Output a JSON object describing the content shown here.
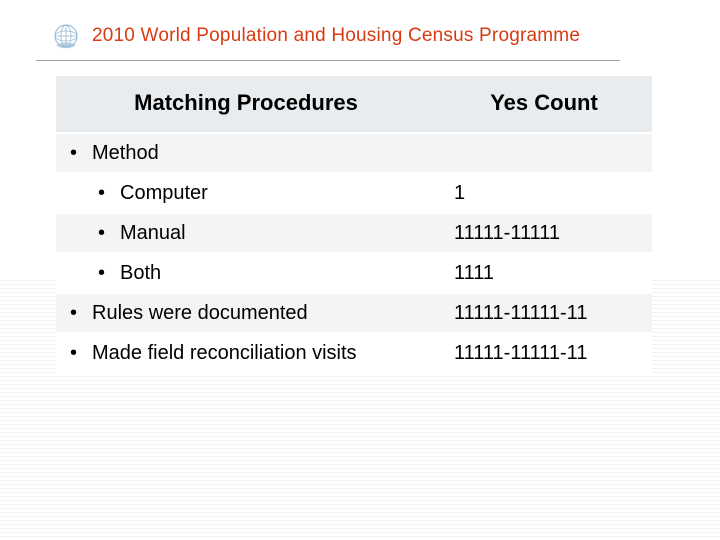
{
  "header": {
    "programme_title": "2010 World Population and Housing Census Programme"
  },
  "table": {
    "columns": {
      "procedures": "Matching Procedures",
      "yes_count": "Yes Count"
    },
    "rows": [
      {
        "level": 1,
        "label": "Method",
        "yes": ""
      },
      {
        "level": 2,
        "label": "Computer",
        "yes": "1"
      },
      {
        "level": 2,
        "label": "Manual",
        "yes": "11111-11111"
      },
      {
        "level": 2,
        "label": "Both",
        "yes": "1111"
      },
      {
        "level": 1,
        "label": "Rules were documented",
        "yes": "11111-11111-11"
      },
      {
        "level": 1,
        "label": "Made field reconciliation visits",
        "yes": "11111-11111-11"
      }
    ]
  },
  "chart_data": {
    "type": "table",
    "title": "Matching Procedures — Yes Count",
    "columns": [
      "Matching Procedures",
      "Yes Count"
    ],
    "rows": [
      [
        "Method",
        ""
      ],
      [
        "Computer",
        "1"
      ],
      [
        "Manual",
        "11111-11111"
      ],
      [
        "Both",
        "1111"
      ],
      [
        "Rules were documented",
        "11111-11111-11"
      ],
      [
        "Made field reconciliation visits",
        "11111-11111-11"
      ]
    ]
  }
}
